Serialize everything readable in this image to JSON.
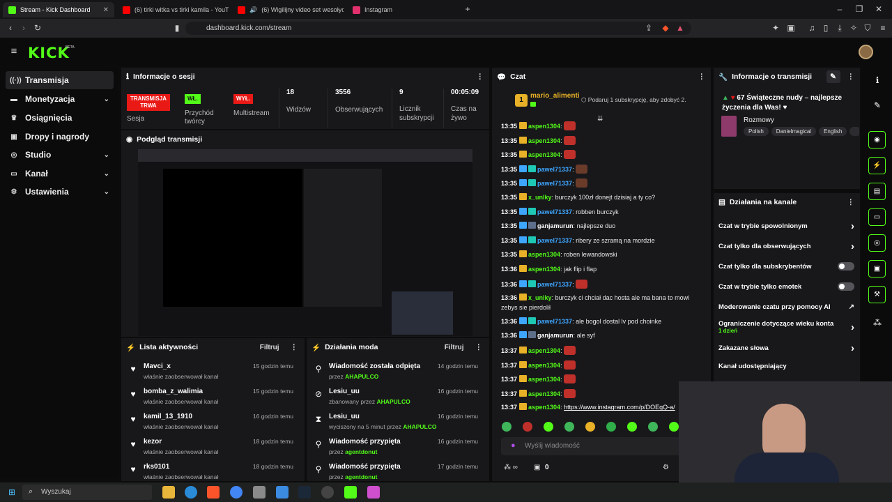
{
  "browser": {
    "tabs": [
      {
        "title": "Stream - Kick Dashboard",
        "fav": "#53fc18"
      },
      {
        "title": "(6) tirki witka vs tirki kamila - YouTube",
        "fav": "#ff0000"
      },
      {
        "title": "(6) Wigilijny video set wesołych św",
        "fav": "#ff0000"
      },
      {
        "title": "Instagram",
        "fav": "#e1306c"
      }
    ],
    "url": "dashboard.kick.com/stream"
  },
  "brand": {
    "logo": "KICK",
    "beta": "BETA"
  },
  "sidebar": {
    "items": [
      {
        "label": "Transmisja",
        "icon": "broadcast-icon"
      },
      {
        "label": "Monetyzacja",
        "icon": "money-icon"
      },
      {
        "label": "Osiągnięcia",
        "icon": "trophy-icon"
      },
      {
        "label": "Dropy i nagrody",
        "icon": "gift-icon"
      },
      {
        "label": "Studio",
        "icon": "studio-icon"
      },
      {
        "label": "Kanał",
        "icon": "channel-icon"
      },
      {
        "label": "Ustawienia",
        "icon": "gear-icon"
      }
    ]
  },
  "session": {
    "title": "Informacje o sesji",
    "status_badge": "TRANSMISJA TRWA",
    "status_label": "Sesja",
    "income_badge": "WŁ.",
    "income_label": "Przychód twórcy",
    "multistream_badge": "WYŁ.",
    "multistream_label": "Multistream",
    "viewers": "18",
    "viewers_label": "Widzów",
    "followers": "3556",
    "followers_label": "Obserwujących",
    "subs": "9",
    "subs_label": "Licznik subskrypcji",
    "uptime": "00:05:09",
    "uptime_label": "Czas na żywo"
  },
  "preview": {
    "title": "Podgląd transmisji"
  },
  "activity": {
    "title": "Lista aktywności",
    "filter": "Filtruj",
    "items": [
      {
        "name": "Mavci_x",
        "sub": "właśnie zaobserwował kanał",
        "time": "15 godzin temu"
      },
      {
        "name": "bomba_z_walimia",
        "sub": "właśnie zaobserwował kanał",
        "time": "15 godzin temu"
      },
      {
        "name": "kamil_13_1910",
        "sub": "właśnie zaobserwował kanał",
        "time": "16 godzin temu"
      },
      {
        "name": "kezor",
        "sub": "właśnie zaobserwował kanał",
        "time": "18 godzin temu"
      },
      {
        "name": "rks0101",
        "sub": "właśnie zaobserwował kanał",
        "time": "18 godzin temu"
      }
    ]
  },
  "modactions": {
    "title": "Działania moda",
    "filter": "Filtruj",
    "items": [
      {
        "name": "Wiadomość została odpięta",
        "pre": "przez",
        "by": "AHAPULCO",
        "time": "14 godzin temu",
        "icon": "unpin-icon"
      },
      {
        "name": "Lesiu_uu",
        "pre": "zbanowany przez",
        "by": "AHAPULCO",
        "time": "16 godzin temu",
        "icon": "ban-icon"
      },
      {
        "name": "Lesiu_uu",
        "pre": "wyciszony na 5 minut przez",
        "by": "AHAPULCO",
        "time": "16 godzin temu",
        "icon": "hourglass-icon"
      },
      {
        "name": "Wiadomość przypięta",
        "pre": "przez",
        "by": "agentdonut",
        "time": "16 godzin temu",
        "icon": "pin-icon"
      },
      {
        "name": "Wiadomość przypięta",
        "pre": "przez",
        "by": "agentdonut",
        "time": "17 godzin temu",
        "icon": "pin-icon"
      }
    ]
  },
  "chat": {
    "title": "Czat",
    "top_gifter": "mario_alimenti",
    "gift_prompt": "Podaruj 1 subskrypcję, aby zdobyć 2.",
    "input_placeholder": "Wyślij wiadomość",
    "points": "0",
    "messages": [
      {
        "time": "13:35",
        "user": "aspen1304",
        "color": "#53fc18",
        "badges": [
          "crown"
        ],
        "text": "",
        "emote": "red"
      },
      {
        "time": "13:35",
        "user": "aspen1304",
        "color": "#53fc18",
        "badges": [
          "crown"
        ],
        "text": "",
        "emote": "red"
      },
      {
        "time": "13:35",
        "user": "aspen1304",
        "color": "#53fc18",
        "badges": [
          "crown"
        ],
        "text": "",
        "emote": "red"
      },
      {
        "time": "13:35",
        "user": "pawel71337",
        "color": "#3ea6ff",
        "badges": [
          "blue",
          "teal"
        ],
        "text": "",
        "emote": "face"
      },
      {
        "time": "13:35",
        "user": "pawel71337",
        "color": "#3ea6ff",
        "badges": [
          "blue",
          "teal"
        ],
        "text": "",
        "emote": "face"
      },
      {
        "time": "13:35",
        "user": "x_unlky",
        "color": "#53fc18",
        "badges": [
          "crown"
        ],
        "text": "burczyk 100zł donejt dzisiaj a ty co?",
        "emote": ""
      },
      {
        "time": "13:35",
        "user": "pawel71337",
        "color": "#3ea6ff",
        "badges": [
          "blue",
          "teal"
        ],
        "text": "robben burczyk",
        "emote": ""
      },
      {
        "time": "13:35",
        "user": "ganjamurun",
        "color": "#ffffff",
        "badges": [
          "blue",
          "grey"
        ],
        "text": "najlepsze duo",
        "emote": ""
      },
      {
        "time": "13:35",
        "user": "pawel71337",
        "color": "#3ea6ff",
        "badges": [
          "blue",
          "teal"
        ],
        "text": "ribery ze szramą na mordzie",
        "emote": ""
      },
      {
        "time": "13:35",
        "user": "aspen1304",
        "color": "#53fc18",
        "badges": [
          "crown"
        ],
        "text": "roben lewandowski",
        "emote": ""
      },
      {
        "time": "13:36",
        "user": "aspen1304",
        "color": "#53fc18",
        "badges": [
          "crown"
        ],
        "text": "jak flip i flap",
        "emote": ""
      },
      {
        "time": "13:36",
        "user": "pawel71337",
        "color": "#3ea6ff",
        "badges": [
          "blue",
          "teal"
        ],
        "text": "",
        "emote": "red"
      },
      {
        "time": "13:36",
        "user": "x_unlky",
        "color": "#53fc18",
        "badges": [
          "crown"
        ],
        "text": "burczyk ci chciał dac hosta ale ma bana to mowi",
        "text2": "zebys sie pierdolił",
        "emote": ""
      },
      {
        "time": "13:36",
        "user": "pawel71337",
        "color": "#3ea6ff",
        "badges": [
          "blue",
          "teal"
        ],
        "text": "ale bogol dostal lv pod choinke",
        "emote": ""
      },
      {
        "time": "13:36",
        "user": "ganjamurun",
        "color": "#ffffff",
        "badges": [
          "blue",
          "grey"
        ],
        "text": "ale syf",
        "emote": ""
      },
      {
        "time": "13:37",
        "user": "aspen1304",
        "color": "#53fc18",
        "badges": [
          "crown"
        ],
        "text": "",
        "emote": "red"
      },
      {
        "time": "13:37",
        "user": "aspen1304",
        "color": "#53fc18",
        "badges": [
          "crown"
        ],
        "text": "",
        "emote": "red"
      },
      {
        "time": "13:37",
        "user": "aspen1304",
        "color": "#53fc18",
        "badges": [
          "crown"
        ],
        "text": "",
        "emote": "red"
      },
      {
        "time": "13:37",
        "user": "aspen1304",
        "color": "#53fc18",
        "badges": [
          "crown"
        ],
        "text": "",
        "emote": "red"
      },
      {
        "time": "13:37",
        "user": "aspen1304",
        "color": "#53fc18",
        "badges": [
          "crown"
        ],
        "text": "https://www.instagram.com/p/DOEgQ-a/",
        "emote": "",
        "link": true
      }
    ]
  },
  "stream_info": {
    "title": "Informacje o transmisji",
    "stream_title": "67 Świąteczne nudy – najlepsze życzenia dla Was!",
    "category": "Rozmowy",
    "tags": [
      "Polish",
      "Danielmagical",
      "English"
    ]
  },
  "channel_actions": {
    "title": "Działania na kanale",
    "items": [
      {
        "label": "Czat w trybie spowolnionym",
        "ctl": "chevron"
      },
      {
        "label": "Czat tylko dla obserwujących",
        "ctl": "chevron"
      },
      {
        "label": "Czat tylko dla subskrybentów",
        "ctl": "toggle"
      },
      {
        "label": "Czat w trybie tylko emotek",
        "ctl": "toggle"
      },
      {
        "label": "Moderowanie czatu przy pomocy AI",
        "ctl": "external"
      },
      {
        "label": "Ograniczenie dotyczące wieku konta",
        "sub": "1 dzień",
        "ctl": "chevron"
      },
      {
        "label": "Zakazane słowa",
        "ctl": "chevron"
      },
      {
        "label": "Kanał udostępniający",
        "ctl": ""
      }
    ]
  },
  "taskbar": {
    "search": "Wyszukaj"
  },
  "colors": {
    "accent": "#53fc18",
    "live": "#e91916",
    "panel": "#18181b"
  }
}
